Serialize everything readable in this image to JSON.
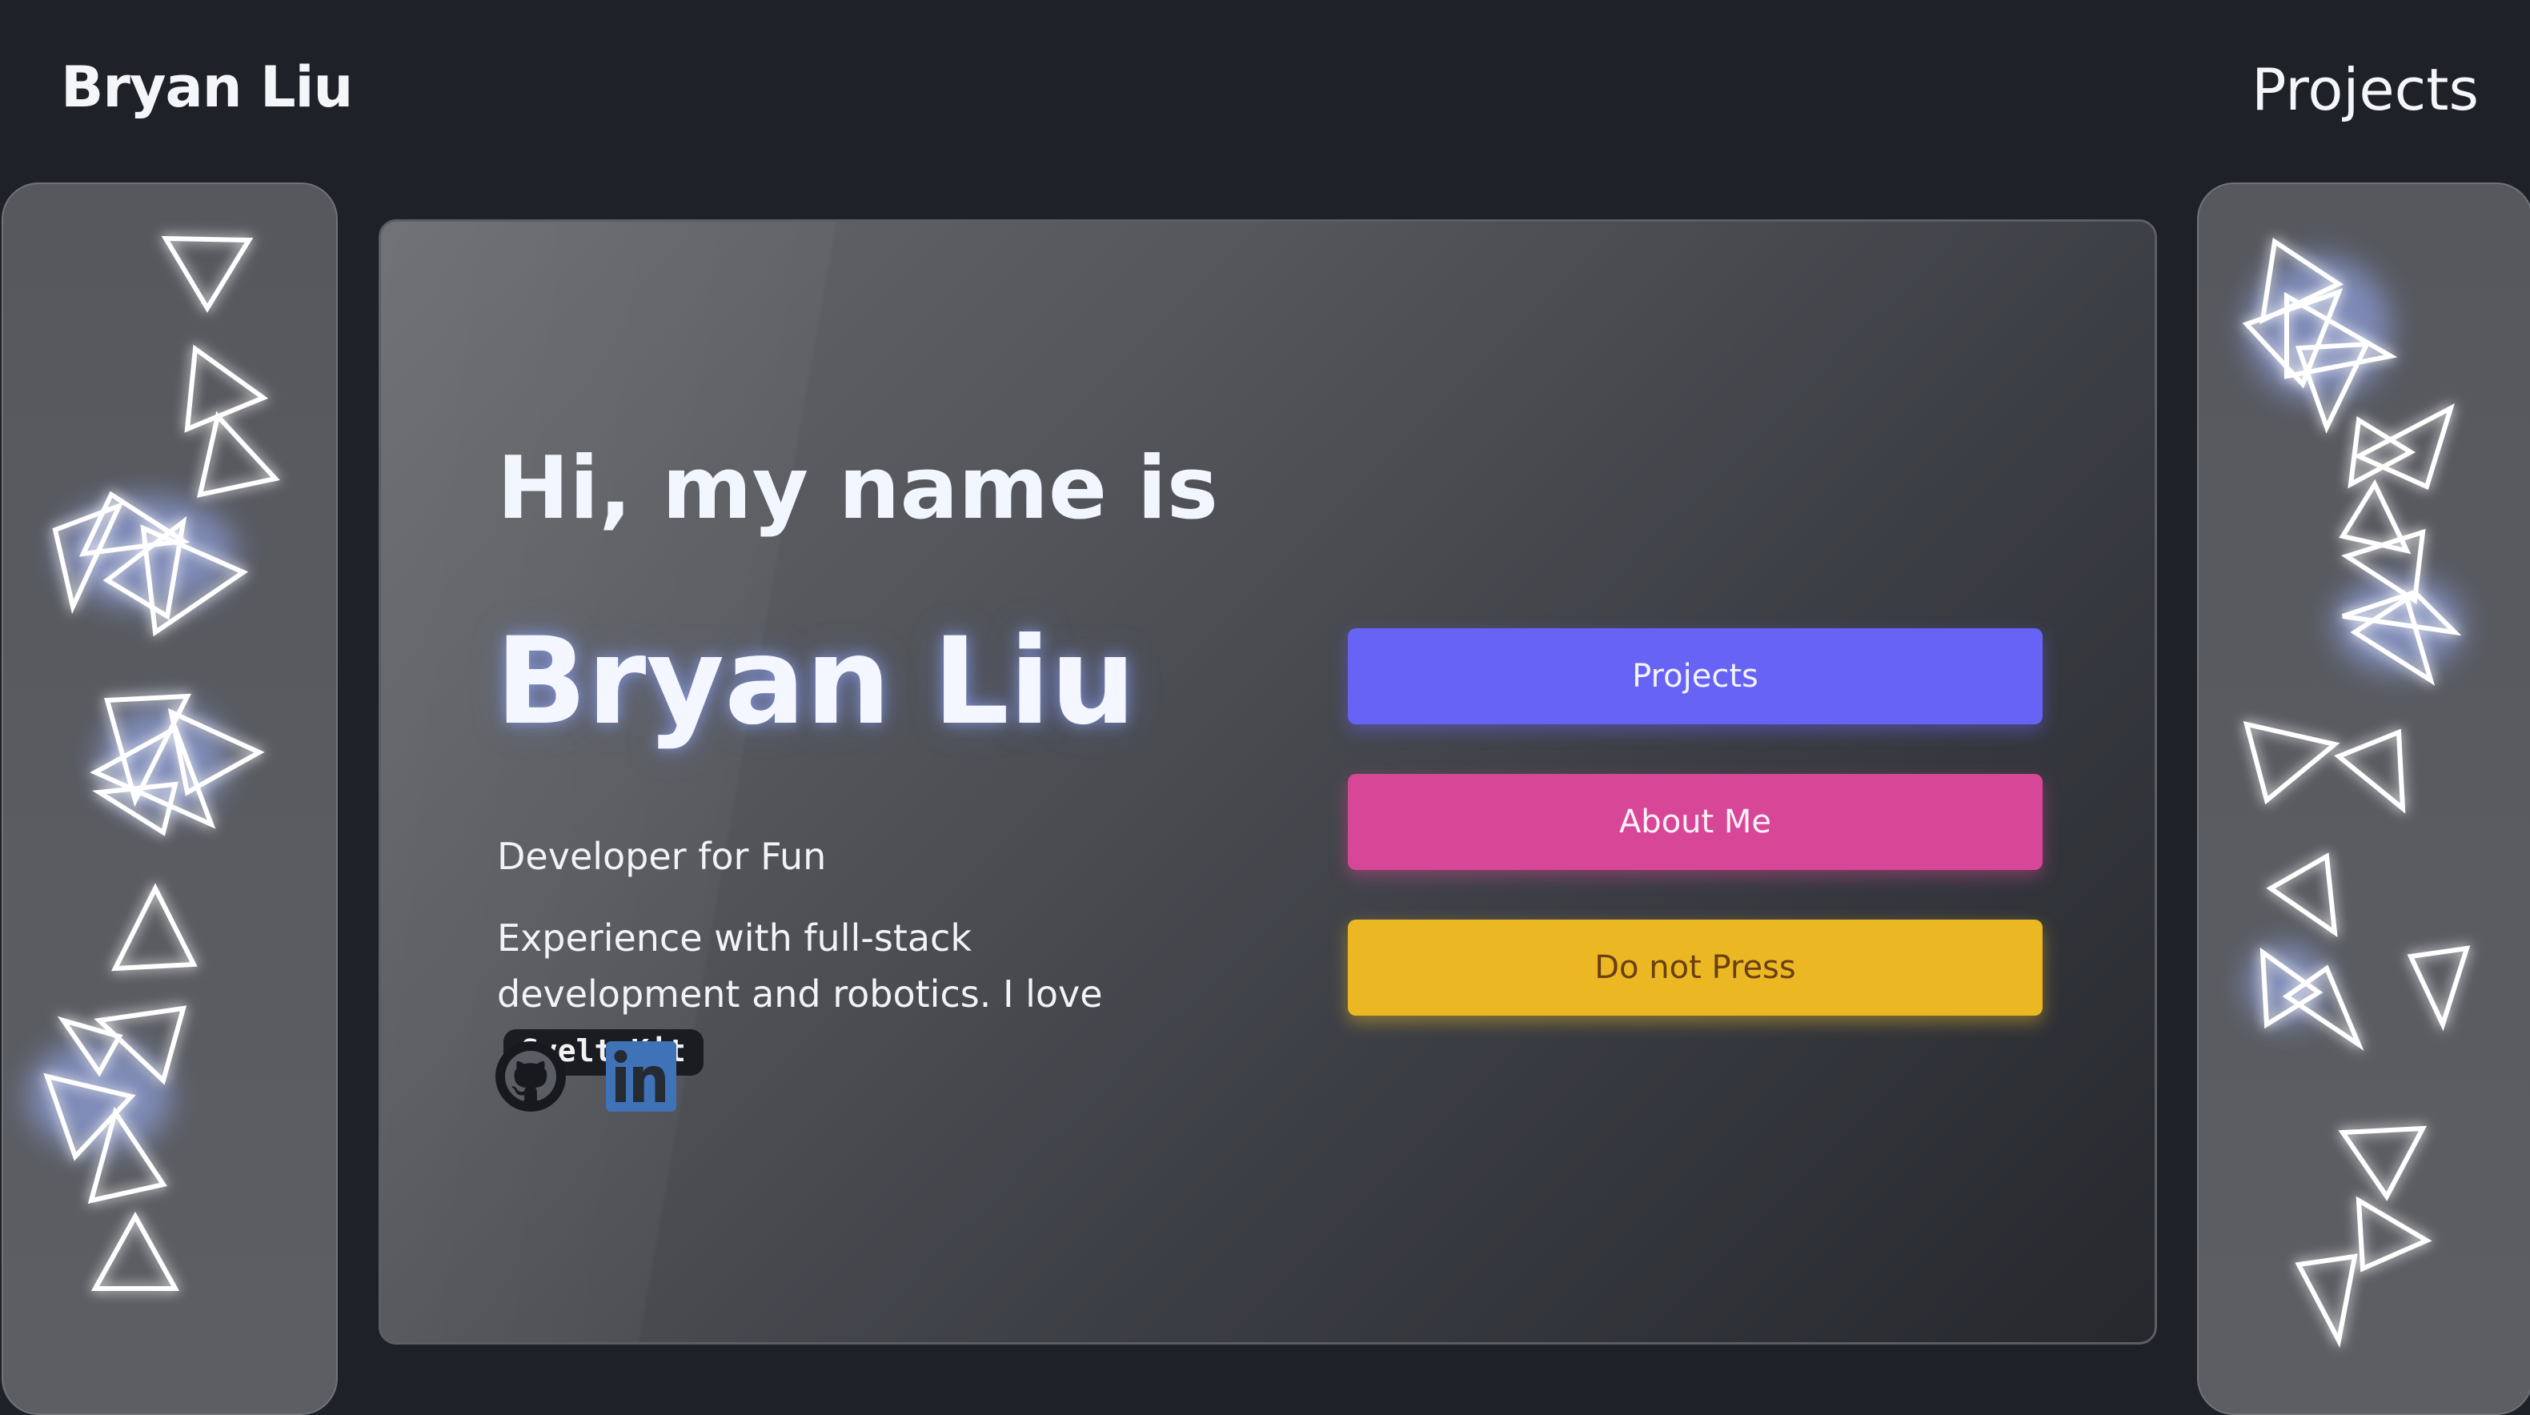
{
  "header": {
    "brand": "Bryan Liu",
    "nav_link": "Projects"
  },
  "hero": {
    "greeting": "Hi, my name is",
    "name": "Bryan Liu",
    "tagline": "Developer for Fun",
    "bio_text": "Experience with full-stack development and robotics. I love ",
    "bio_code": "SvelteKit",
    "socials": [
      {
        "icon": "github-icon"
      },
      {
        "icon": "linkedin-icon"
      }
    ],
    "buttons": [
      {
        "label": "Projects",
        "color": "#6763f5"
      },
      {
        "label": "About Me",
        "color": "#d84797"
      },
      {
        "label": "Do not Press",
        "color": "#ebb824"
      }
    ]
  },
  "decor": {
    "side_panels": "floating glowing triangle outlines",
    "accent_glow": "#9fb4ff"
  }
}
